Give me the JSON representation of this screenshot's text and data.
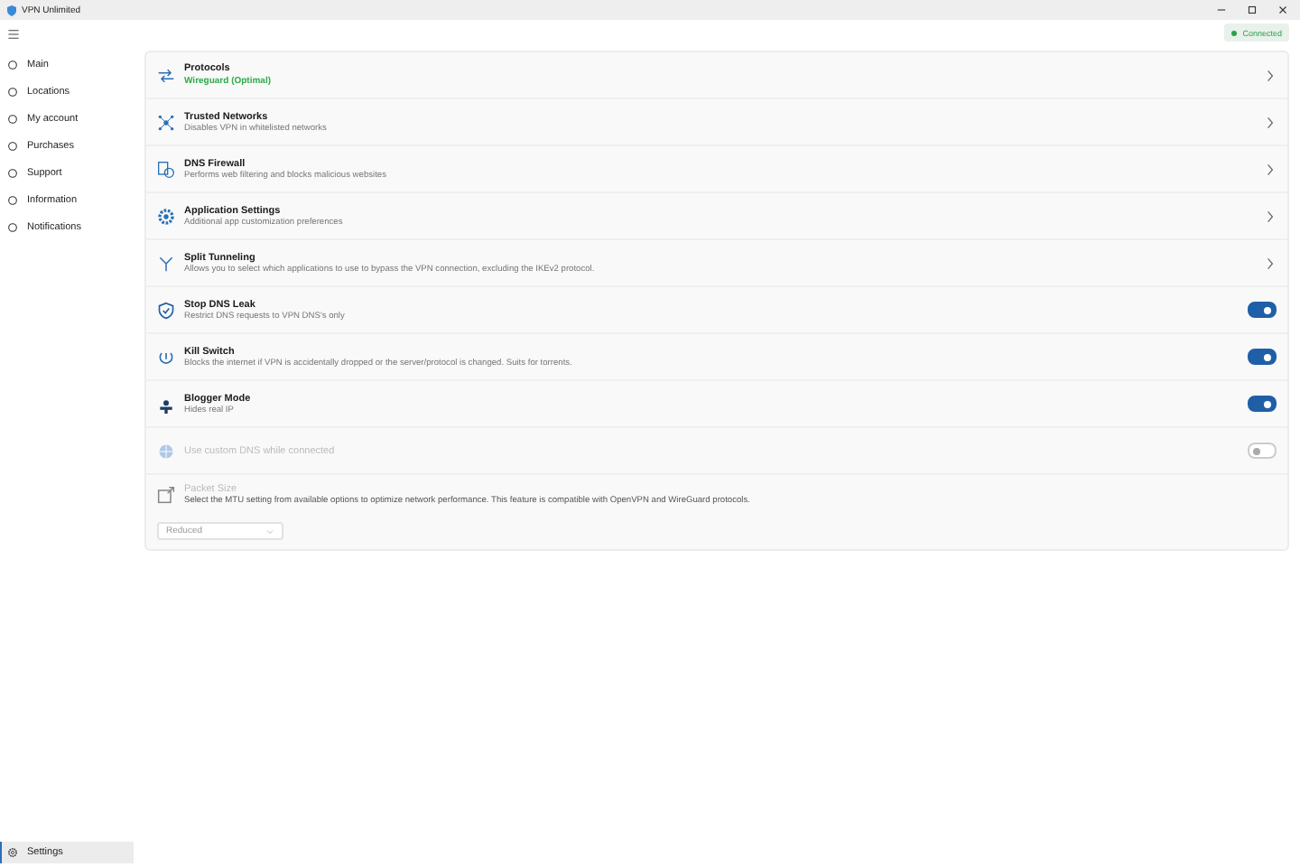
{
  "window": {
    "title": "VPN Unlimited"
  },
  "status": {
    "label": "Connected",
    "color": "#2e9e4f"
  },
  "sidebar": {
    "items": [
      {
        "label": "Main",
        "selected": false
      },
      {
        "label": "Locations",
        "selected": false
      },
      {
        "label": "My account",
        "selected": false
      },
      {
        "label": "Purchases",
        "selected": false
      },
      {
        "label": "Support",
        "selected": false
      },
      {
        "label": "Information",
        "selected": false
      },
      {
        "label": "Notifications",
        "selected": false
      }
    ],
    "footer_item": {
      "label": "Settings",
      "selected": true
    }
  },
  "settings": [
    {
      "kind": "nav",
      "title": "Protocols",
      "value": "Wireguard (Optimal)",
      "disabled": false
    },
    {
      "kind": "nav",
      "title": "Trusted Networks",
      "description": "Disables VPN in whitelisted networks",
      "disabled": false
    },
    {
      "kind": "nav",
      "title": "DNS Firewall",
      "description": "Performs web filtering and blocks malicious websites",
      "disabled": false
    },
    {
      "kind": "nav",
      "title": "Application Settings",
      "description": "Additional app customization preferences",
      "disabled": false
    },
    {
      "kind": "nav",
      "title": "Split Tunneling",
      "description": "Allows you to select which applications to use to bypass the VPN connection, excluding the IKEv2 protocol.",
      "disabled": false
    },
    {
      "kind": "toggle",
      "title": "Stop DNS Leak",
      "description": "Restrict DNS requests to VPN DNS's only",
      "on": true,
      "disabled": false
    },
    {
      "kind": "toggle",
      "title": "Kill Switch",
      "description": "Blocks the internet if VPN is accidentally dropped or the server/protocol is changed. Suits for torrents.",
      "on": true,
      "disabled": false
    },
    {
      "kind": "toggle",
      "title": "Blogger Mode",
      "description": "Hides real IP",
      "on": true,
      "disabled": false
    },
    {
      "kind": "toggle",
      "title": "Use custom DNS while connected",
      "on": false,
      "disabled": true
    },
    {
      "kind": "select",
      "title": "Packet Size",
      "description": "Select the MTU setting from available options to optimize network performance. This feature is compatible with OpenVPN and WireGuard protocols.",
      "value": "Reduced",
      "disabled": true
    }
  ]
}
